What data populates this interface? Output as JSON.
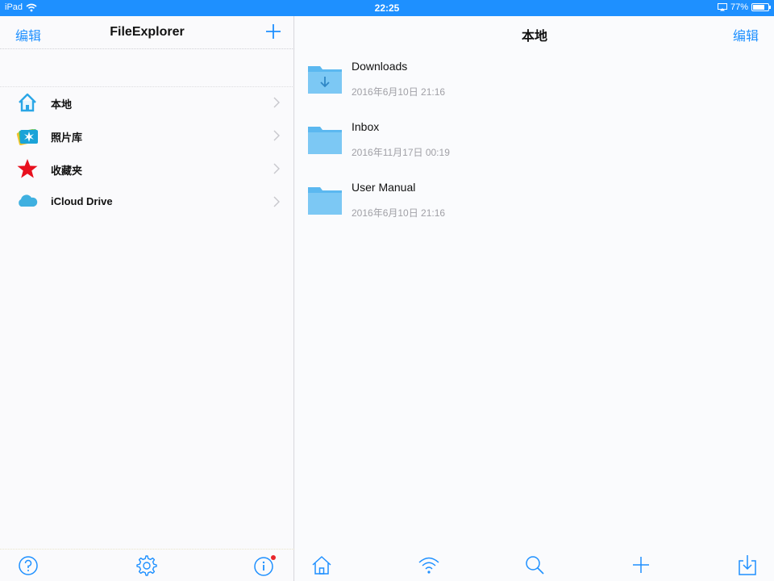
{
  "status_bar": {
    "device": "iPad",
    "time": "22:25",
    "battery": "77%",
    "battery_level": 0.77
  },
  "sidebar": {
    "edit_label": "编辑",
    "title": "FileExplorer",
    "items": [
      {
        "label": "本地",
        "icon": "home-icon"
      },
      {
        "label": "照片库",
        "icon": "photos-icon"
      },
      {
        "label": "收藏夹",
        "icon": "star-icon"
      },
      {
        "label": "iCloud Drive",
        "icon": "cloud-icon"
      }
    ],
    "footer_icons": [
      "help-icon",
      "settings-gear-icon",
      "info-icon"
    ]
  },
  "main": {
    "title": "本地",
    "edit_label": "编辑",
    "files": [
      {
        "name": "Downloads",
        "date": "2016年6月10日 21:16",
        "icon": "downloads-folder-icon"
      },
      {
        "name": "Inbox",
        "date": "2016年11月17日 00:19",
        "icon": "folder-icon"
      },
      {
        "name": "User Manual",
        "date": "2016年6月10日 21:16",
        "icon": "folder-icon"
      }
    ],
    "footer_icons": [
      "home-icon",
      "wifi-icon",
      "search-icon",
      "add-icon",
      "import-icon"
    ]
  },
  "colors": {
    "accent": "#1e90ff",
    "folder": "#5bb8f0",
    "star": "#e8101e",
    "badge": "#e8262c"
  }
}
